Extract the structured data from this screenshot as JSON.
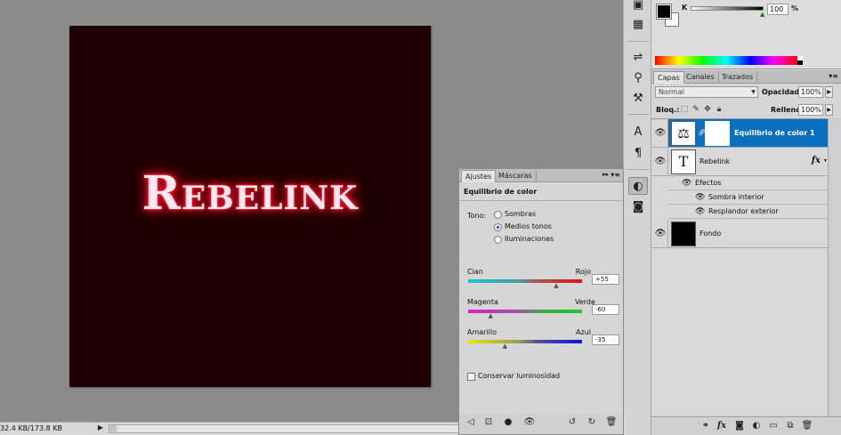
{
  "canvas": {
    "text": "Rebelink"
  },
  "status": {
    "doc_size": "32.4 KB/173.8 KB"
  },
  "color_panel": {
    "channel": "K",
    "value": "100",
    "unit": "%"
  },
  "layers_panel": {
    "tabs": [
      "Capas",
      "Canales",
      "Trazados"
    ],
    "blend_mode": "Normal",
    "opacity_label": "Opacidad:",
    "opacity_value": "100%",
    "lock_label": "Bloq.:",
    "fill_label": "Relleno:",
    "fill_value": "100%",
    "layers": [
      {
        "name": "Equilibrio de color 1",
        "selected": true
      },
      {
        "name": "Rebelink",
        "effects_label": "Efectos",
        "effects": [
          "Sombra interior",
          "Resplandor exterior"
        ]
      },
      {
        "name": "Fondo"
      }
    ]
  },
  "adjust_panel": {
    "tabs": [
      "Ajustes",
      "Máscaras"
    ],
    "heading": "Equilibrio de color",
    "tone_label": "Tono:",
    "tone_options": [
      "Sombras",
      "Medios tonos",
      "Iluminaciones"
    ],
    "tone_selected": "Medios tonos",
    "sliders": [
      {
        "left": "Cian",
        "right": "Rojo",
        "value": "+55",
        "level": 55
      },
      {
        "left": "Magenta",
        "right": "Verde",
        "value": "-60",
        "level": -60
      },
      {
        "left": "Amarillo",
        "right": "Azul",
        "value": "-35",
        "level": -35
      }
    ],
    "preserve_label": "Conservar luminosidad",
    "preserve_checked": false
  },
  "icons": {
    "dock": [
      "mini-bridge-icon",
      "histogram-icon",
      "brush-presets-icon",
      "clone-source-icon",
      "tool-presets-icon",
      "character-icon",
      "paragraph-icon",
      "adjustments-icon",
      "masks-icon"
    ],
    "layers_footer": [
      "link-icon",
      "fx-icon",
      "mask-icon",
      "adjustment-layer-icon",
      "group-icon",
      "new-layer-icon",
      "trash-icon"
    ],
    "adjust_footer": [
      "back-icon",
      "fit-icon",
      "clip-icon",
      "visibility-icon",
      "view-previous-icon",
      "reset-icon",
      "trash-icon"
    ]
  }
}
